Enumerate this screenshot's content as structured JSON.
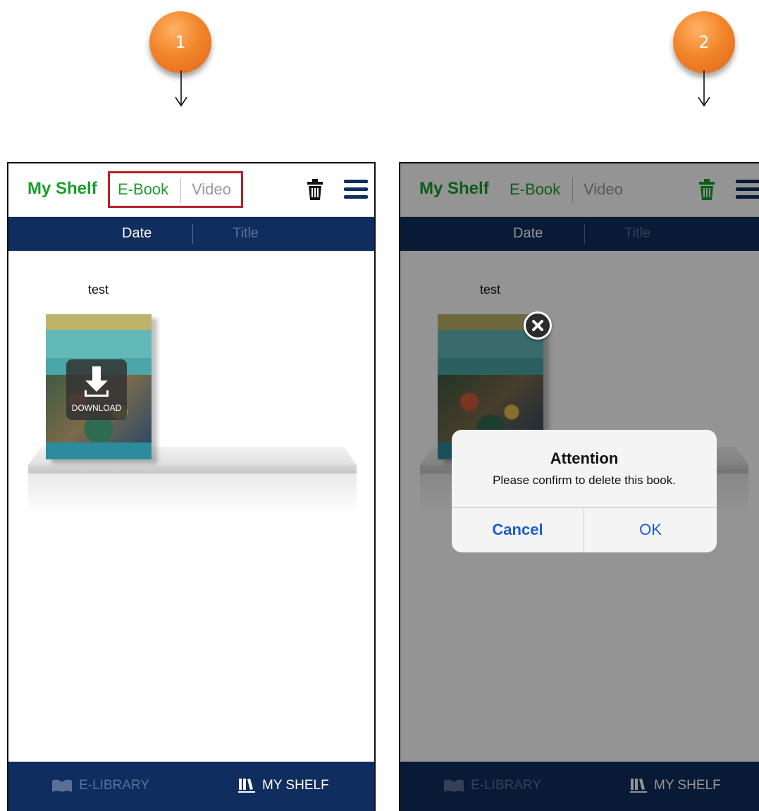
{
  "steps": [
    {
      "number": "1"
    },
    {
      "number": "2"
    }
  ],
  "panel1": {
    "header": {
      "title": "My Shelf",
      "tab_ebook": "E-Book",
      "tab_video": "Video"
    },
    "sort": {
      "date": "Date",
      "title": "Title"
    },
    "shelf": {
      "label": "test",
      "download_label": "DOWNLOAD"
    },
    "tabbar": {
      "library": "E-LIBRARY",
      "myshelf": "MY SHELF"
    }
  },
  "panel2": {
    "header": {
      "title": "My Shelf",
      "tab_ebook": "E-Book",
      "tab_video": "Video"
    },
    "sort": {
      "date": "Date",
      "title": "Title"
    },
    "shelf": {
      "label": "test"
    },
    "alert": {
      "title": "Attention",
      "message": "Please confirm to delete this book.",
      "cancel": "Cancel",
      "ok": "OK"
    },
    "tabbar": {
      "library": "E-LIBRARY",
      "myshelf": "MY SHELF"
    }
  },
  "colors": {
    "brand_green": "#17a02a",
    "navy": "#0f2d5e",
    "highlight_red": "#b52028",
    "step_orange": "#f2862b",
    "ios_blue": "#1a5fd0"
  },
  "icons": [
    "trash-icon",
    "menu-icon",
    "download-icon",
    "open-book-icon",
    "books-icon",
    "close-icon",
    "down-arrow-icon"
  ]
}
